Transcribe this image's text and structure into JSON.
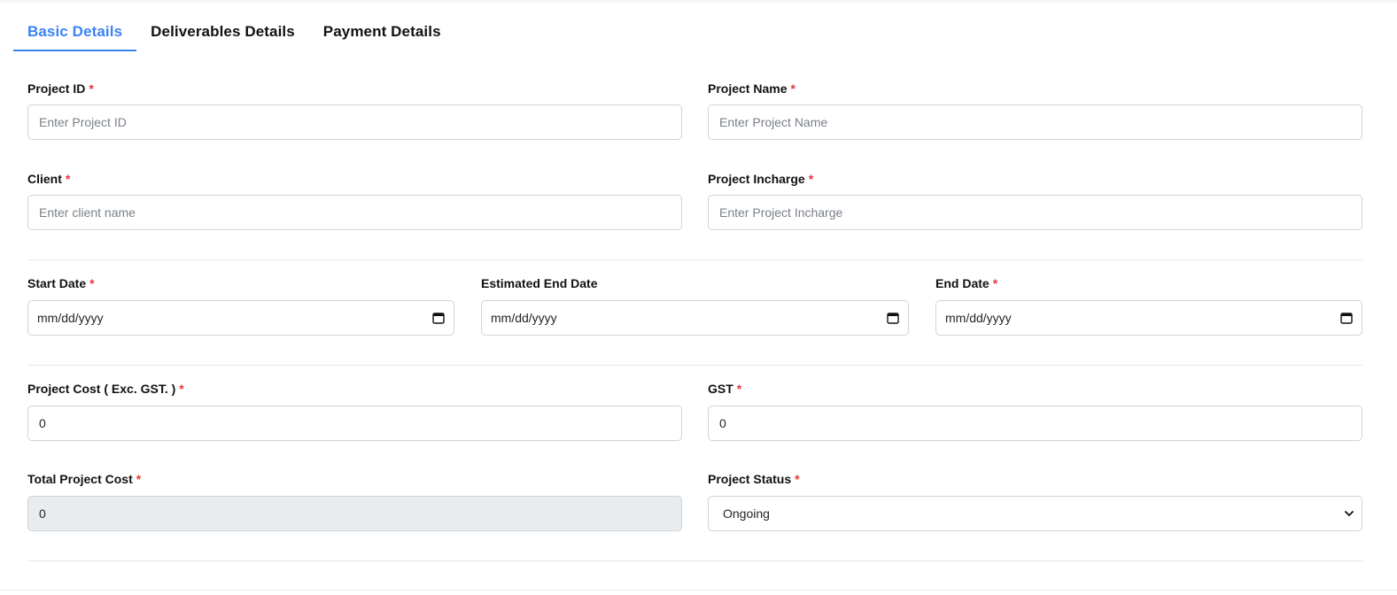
{
  "tabs": [
    {
      "label": "Basic Details",
      "active": true
    },
    {
      "label": "Deliverables Details",
      "active": false
    },
    {
      "label": "Payment Details",
      "active": false
    }
  ],
  "fields": {
    "project_id": {
      "label": "Project ID",
      "required": "*",
      "placeholder": "Enter Project ID"
    },
    "project_name": {
      "label": "Project Name",
      "required": "*",
      "placeholder": "Enter Project Name"
    },
    "client": {
      "label": "Client",
      "required": "*",
      "placeholder": "Enter client name"
    },
    "project_incharge": {
      "label": "Project Incharge",
      "required": "*",
      "placeholder": "Enter Project Incharge"
    },
    "start_date": {
      "label": "Start Date",
      "required": "*",
      "value": "mm/dd/yyyy"
    },
    "estimated_end_date": {
      "label": "Estimated End Date",
      "value": "mm/dd/yyyy"
    },
    "end_date": {
      "label": "End Date",
      "required": "*",
      "value": "mm/dd/yyyy"
    },
    "project_cost": {
      "label": "Project Cost ( Exc. GST. )",
      "required": "*",
      "value": "0"
    },
    "gst": {
      "label": "GST",
      "required": "*",
      "value": "0"
    },
    "total_project_cost": {
      "label": "Total Project Cost",
      "required": "*",
      "value": "0"
    },
    "project_status": {
      "label": "Project Status",
      "required": "*",
      "value": "Ongoing"
    }
  },
  "icons": {
    "calendar": "calendar-icon",
    "select": "chevron-down-icon"
  },
  "colors": {
    "accent": "#3b82f6",
    "required": "#e53935",
    "readonly_bg": "#e9ecef"
  }
}
